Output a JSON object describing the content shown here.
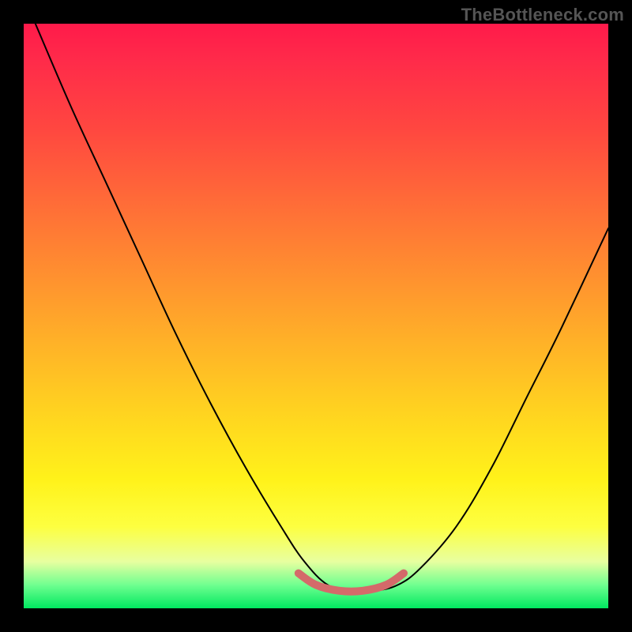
{
  "watermark": "TheBottleneck.com",
  "colors": {
    "frame_background": "#000000",
    "curve_stroke": "#000000",
    "trough_stroke": "#d46a6a",
    "gradient_top": "#ff1a4a",
    "gradient_bottom": "#00e860"
  },
  "chart_data": {
    "type": "line",
    "title": "",
    "xlabel": "",
    "ylabel": "",
    "xlim": [
      0,
      100
    ],
    "ylim": [
      0,
      100
    ],
    "grid": false,
    "legend": false,
    "series": [
      {
        "name": "bottleneck-curve",
        "x": [
          2,
          8,
          14,
          20,
          26,
          32,
          38,
          44,
          48,
          52,
          56,
          60,
          64,
          68,
          74,
          80,
          86,
          92,
          100
        ],
        "y": [
          100,
          86,
          73,
          60,
          47,
          35,
          24,
          14,
          8,
          4,
          3,
          3,
          4,
          7,
          14,
          24,
          36,
          48,
          65
        ]
      }
    ],
    "annotations": [
      {
        "name": "optimal-trough",
        "x": [
          47,
          50,
          54,
          58,
          62,
          65
        ],
        "y": [
          6,
          4,
          3,
          3,
          4,
          6
        ]
      }
    ]
  }
}
